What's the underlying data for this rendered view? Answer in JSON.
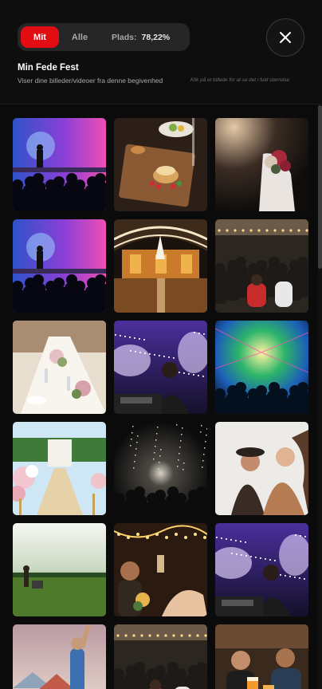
{
  "filter": {
    "tab_mine": "Mit",
    "tab_all": "Alle",
    "storage_label": "Plads:",
    "storage_value": "78,22%"
  },
  "event": {
    "title": "Min Fede Fest",
    "subtitle": "Viser dine billeder/videoer fra denne begivenhed",
    "hint": "Klik på et billede for at se det i fuld størrelse"
  },
  "icons": {
    "close": "close-icon"
  },
  "colors": {
    "accent": "#e20d13",
    "background": "#0b0b0b",
    "pill": "#262626"
  },
  "gallery": {
    "photos": [
      {
        "scene": "concert-stage-pink"
      },
      {
        "scene": "food-platter"
      },
      {
        "scene": "bride-bouquet"
      },
      {
        "scene": "concert-stage-pink"
      },
      {
        "scene": "barn-venue-lights"
      },
      {
        "scene": "crowded-hall-party"
      },
      {
        "scene": "wedding-table-setting"
      },
      {
        "scene": "dj-confetti"
      },
      {
        "scene": "concert-laser-lights"
      },
      {
        "scene": "wedding-aisle-flowers"
      },
      {
        "scene": "dark-concert-crowd"
      },
      {
        "scene": "women-laughing"
      },
      {
        "scene": "field-sunset"
      },
      {
        "scene": "toast-string-lights"
      },
      {
        "scene": "dj-confetti"
      },
      {
        "scene": "festival-camping"
      },
      {
        "scene": "crowded-hall-party"
      },
      {
        "scene": "friends-drinks"
      }
    ]
  }
}
